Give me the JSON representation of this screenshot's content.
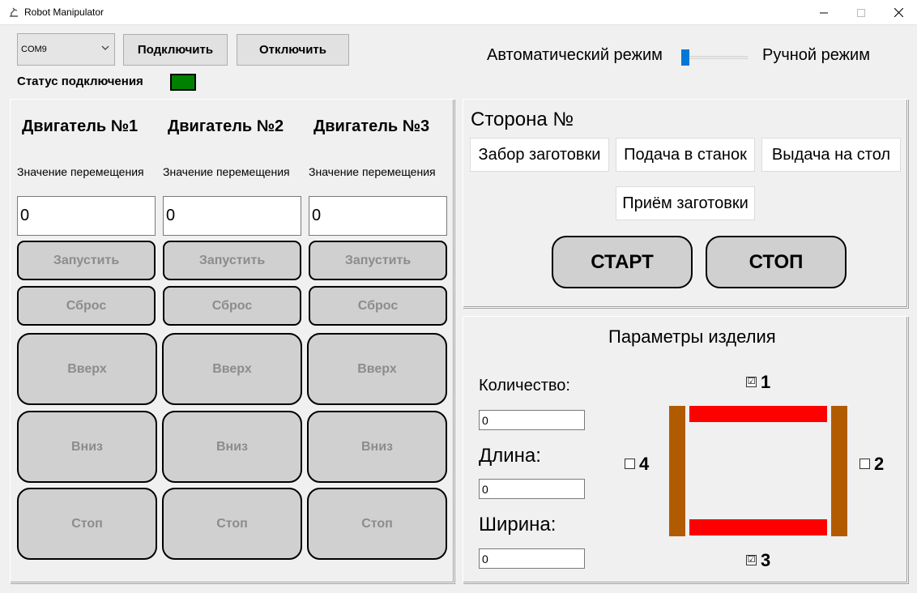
{
  "window": {
    "title": "Robot Manipulator",
    "icon": "robot-arm-icon",
    "controls": {
      "minimize": "—",
      "maximize": "☐",
      "close": "✕"
    }
  },
  "connection": {
    "port_selected": "COM9",
    "connect_label": "Подключить",
    "disconnect_label": "Отключить",
    "status_label": "Статус подключения",
    "status_color": "#008000"
  },
  "mode": {
    "auto_label": "Автоматический режим",
    "manual_label": "Ручной режим",
    "accent": "#0078d7"
  },
  "motors": [
    {
      "title": "Двигатель №1",
      "move_label": "Значение перемещения",
      "value": "0",
      "run": "Запустить",
      "reset": "Сброс",
      "up": "Вверх",
      "down": "Вниз",
      "stop": "Стоп"
    },
    {
      "title": "Двигатель №2",
      "move_label": "Значение перемещения",
      "value": "0",
      "run": "Запустить",
      "reset": "Сброс",
      "up": "Вверх",
      "down": "Вниз",
      "stop": "Стоп"
    },
    {
      "title": "Двигатель №3",
      "move_label": "Значение перемещения",
      "value": "0",
      "run": "Запустить",
      "reset": "Сброс",
      "up": "Вверх",
      "down": "Вниз",
      "stop": "Стоп"
    }
  ],
  "side": {
    "title": "Сторона №",
    "pick_label": "Забор заготовки",
    "feed_label": "Подача в станок",
    "output_label": "Выдача на стол",
    "receive_label": "Приём заготовки",
    "start_label": "СТАРТ",
    "stop_label": "СТОП"
  },
  "params": {
    "title": "Параметры изделия",
    "quantity_label": "Количество:",
    "quantity_value": "0",
    "length_label": "Длина:",
    "length_value": "0",
    "width_label": "Ширина:",
    "width_value": "0",
    "sides": [
      {
        "num": "1",
        "checked": true,
        "mark": "☑"
      },
      {
        "num": "2",
        "checked": false,
        "mark": ""
      },
      {
        "num": "3",
        "checked": true,
        "mark": "☑"
      },
      {
        "num": "4",
        "checked": false,
        "mark": ""
      }
    ],
    "colors": {
      "red_side": "#ff0000",
      "brown_side": "#b15b00"
    }
  }
}
